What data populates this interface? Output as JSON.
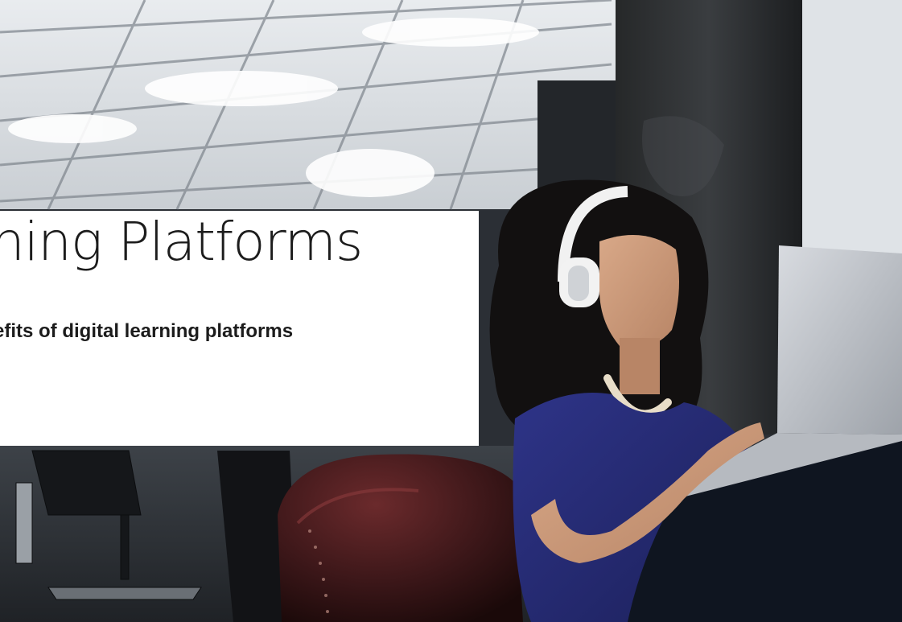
{
  "hero": {
    "title": "rning Platforms",
    "subtitle": "efits of digital learning platforms"
  },
  "colors": {
    "title_text": "#1c1c1c",
    "card_background": "#ffffff",
    "shirt": "#2a2f7a",
    "chair": "#3a1618",
    "laptop": "#c9ccd1",
    "pillar": "#2f3235"
  },
  "icons": {
    "headphones": "headphones-icon"
  }
}
